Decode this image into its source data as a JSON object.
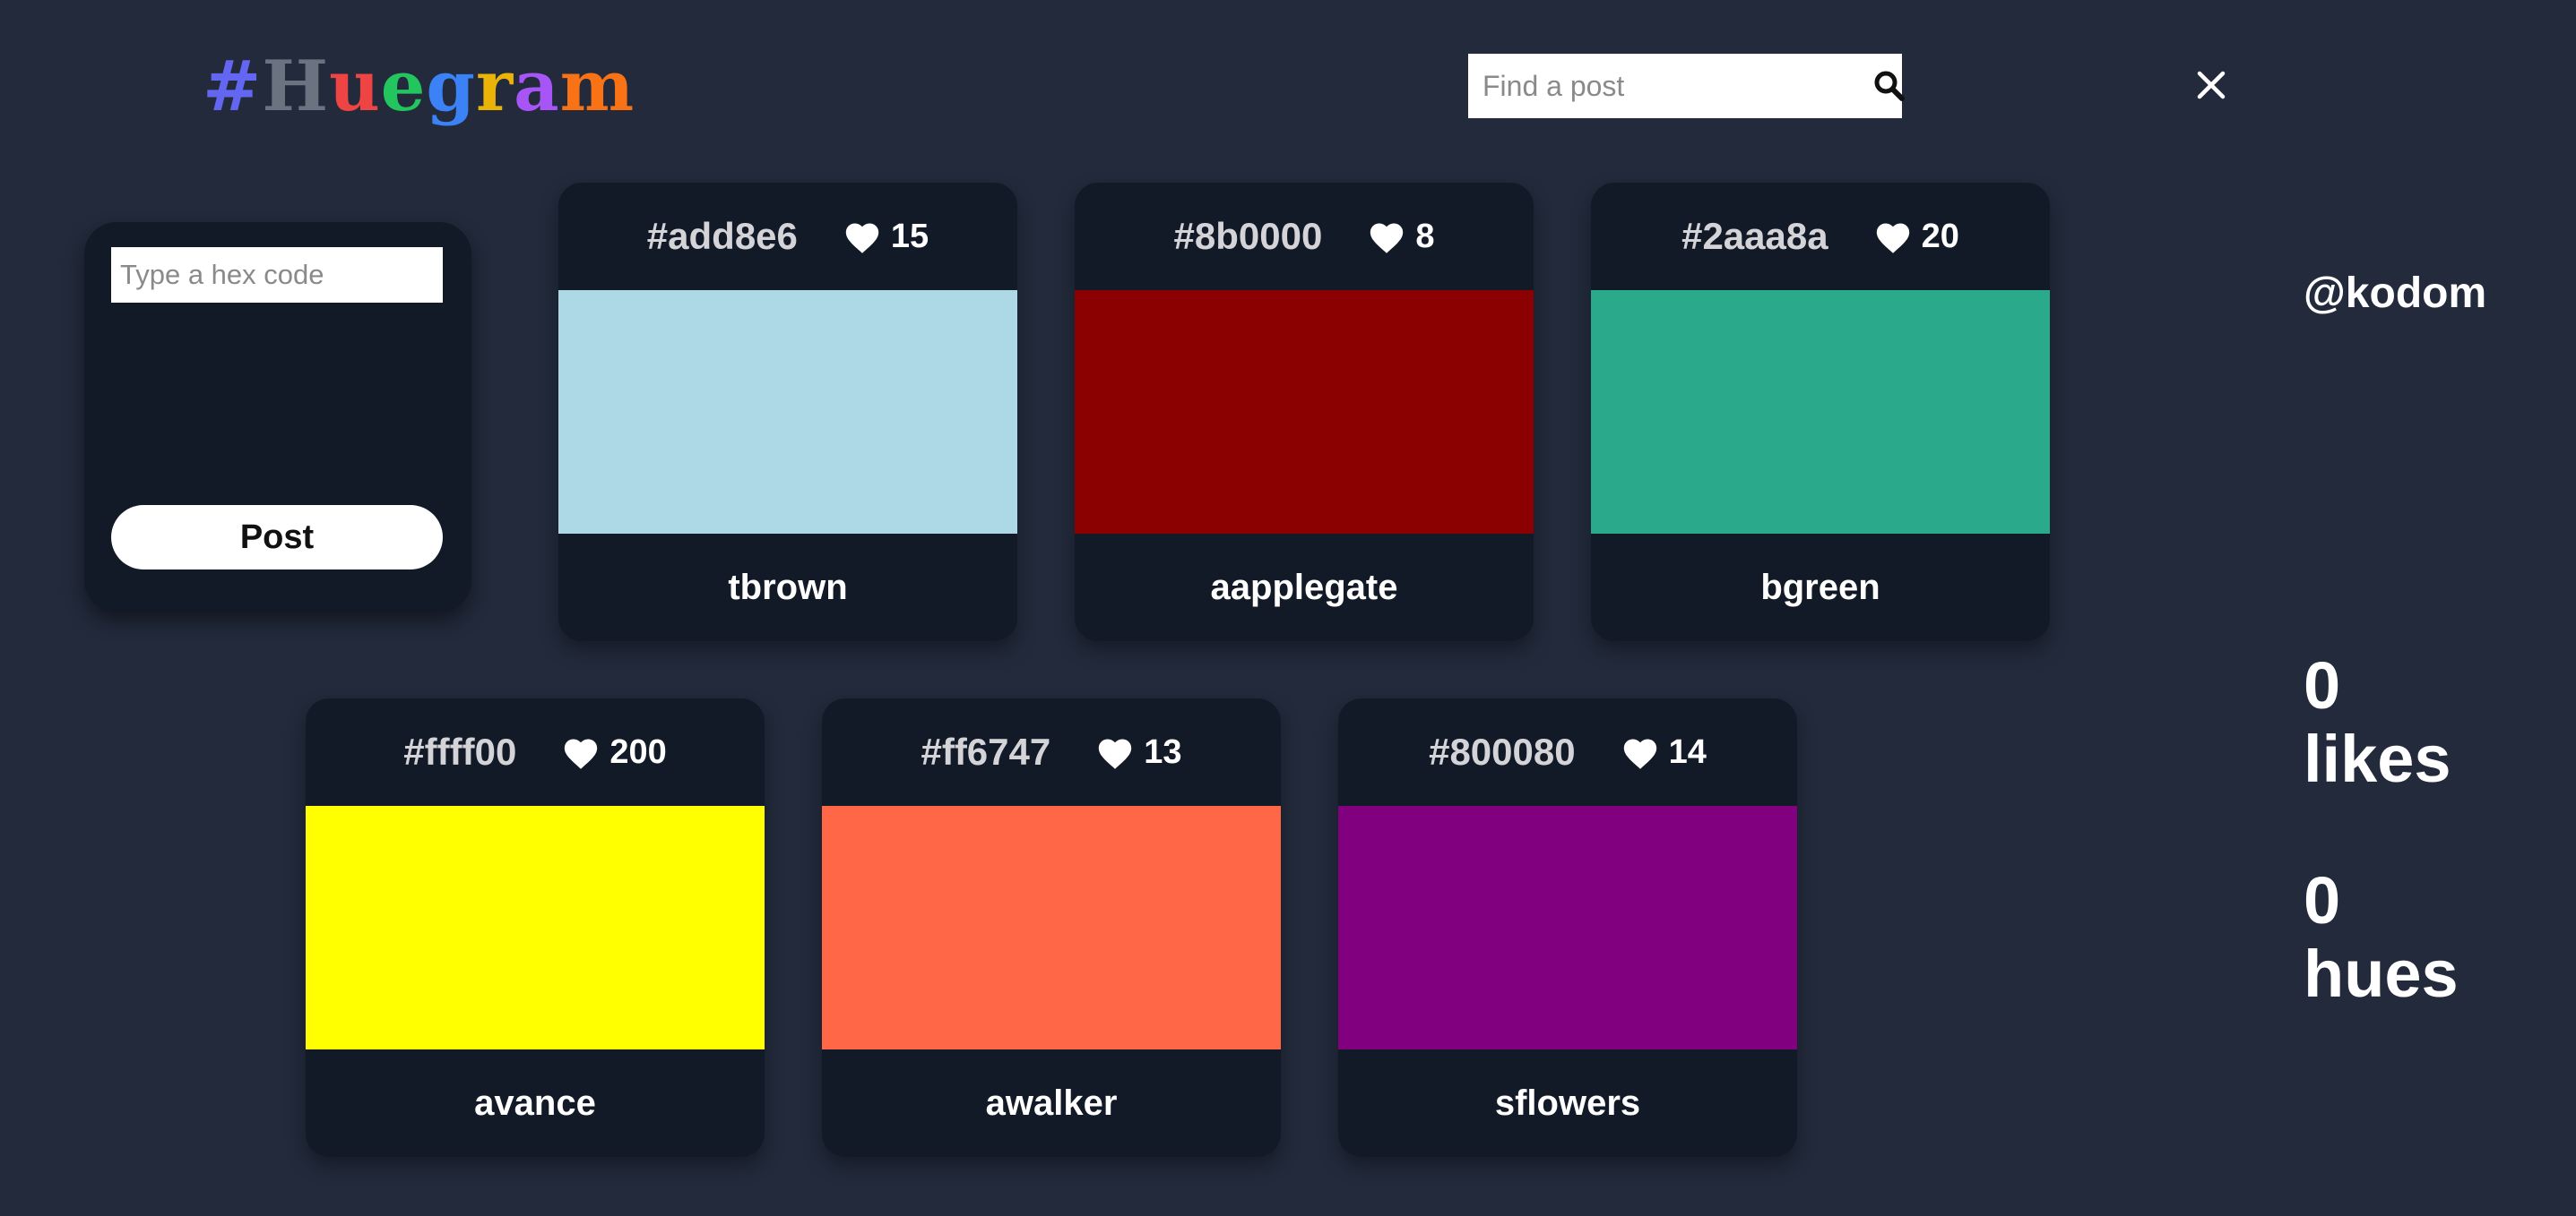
{
  "logo": {
    "chars": [
      {
        "ch": "#",
        "color": "#6366f1"
      },
      {
        "ch": "H",
        "color": "#6b7280"
      },
      {
        "ch": "u",
        "color": "#ef4444"
      },
      {
        "ch": "e",
        "color": "#22c55e"
      },
      {
        "ch": "g",
        "color": "#3b82f6"
      },
      {
        "ch": "r",
        "color": "#eab308"
      },
      {
        "ch": "a",
        "color": "#a855f7"
      },
      {
        "ch": "m",
        "color": "#f97316"
      }
    ]
  },
  "search": {
    "placeholder": "Find a post",
    "icon": "search-icon"
  },
  "close": {
    "icon": "close-icon"
  },
  "composer": {
    "placeholder": "Type a hex code",
    "button_label": "Post"
  },
  "posts": [
    {
      "hex": "#add8e6",
      "likes": "15",
      "user": "tbrown",
      "color": "#add8e6"
    },
    {
      "hex": "#8b0000",
      "likes": "8",
      "user": "aapplegate",
      "color": "#8b0000"
    },
    {
      "hex": "#2aaa8a",
      "likes": "20",
      "user": "bgreen",
      "color": "#2aaa8a"
    },
    {
      "hex": "#ffff00",
      "likes": "200",
      "user": "avance",
      "color": "#ffff00"
    },
    {
      "hex": "#ff6747",
      "likes": "13",
      "user": "awalker",
      "color": "#ff6747"
    },
    {
      "hex": "#800080",
      "likes": "14",
      "user": "sflowers",
      "color": "#800080"
    }
  ],
  "profile": {
    "username": "@kodom",
    "likes_count": "0",
    "likes_label": "likes",
    "hues_count": "0",
    "hues_label": "hues"
  }
}
